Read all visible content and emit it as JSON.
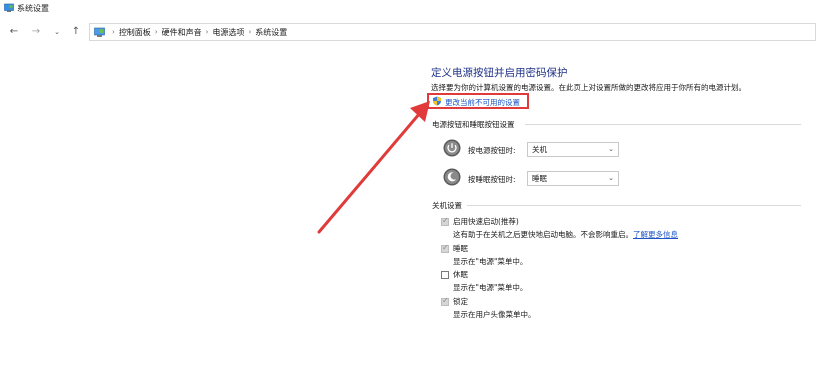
{
  "window": {
    "title": "系统设置"
  },
  "nav": {
    "back_icon": "back-arrow-icon",
    "forward_icon": "forward-arrow-icon",
    "recent_icon": "chevron-down-icon",
    "up_icon": "up-arrow-icon"
  },
  "breadcrumb": {
    "items": [
      "控制面板",
      "硬件和声音",
      "电源选项",
      "系统设置"
    ],
    "separator": "›"
  },
  "main": {
    "heading": "定义电源按钮并启用密码保护",
    "description": "选择要为你的计算机设置的电源设置。在此页上对设置所做的更改将应用于你所有的电源计划。",
    "change_link": "更改当前不可用的设置",
    "buttons_section": {
      "title": "电源按钮和睡眠按钮设置",
      "power_label": "按电源按钮时:",
      "power_value": "关机",
      "sleep_label": "按睡眠按钮时:",
      "sleep_value": "睡眠"
    },
    "shutdown_section": {
      "title": "关机设置",
      "fast_startup_label": "启用快速启动(推荐)",
      "fast_startup_desc": "这有助于在关机之后更快地启动电脑。不会影响重启。",
      "learn_more": "了解更多信息",
      "sleep_label": "睡眠",
      "sleep_desc": "显示在\"电源\"菜单中。",
      "hibernate_label": "休眠",
      "hibernate_desc": "显示在\"电源\"菜单中。",
      "lock_label": "锁定",
      "lock_desc": "显示在用户头像菜单中。"
    }
  },
  "checkboxes": {
    "fast_startup": true,
    "sleep": true,
    "hibernate": false,
    "lock": true
  },
  "colors": {
    "heading": "#1e3287",
    "link": "#1b54c4",
    "highlight": "#e03a3a",
    "arrow": "#e03a3a"
  }
}
